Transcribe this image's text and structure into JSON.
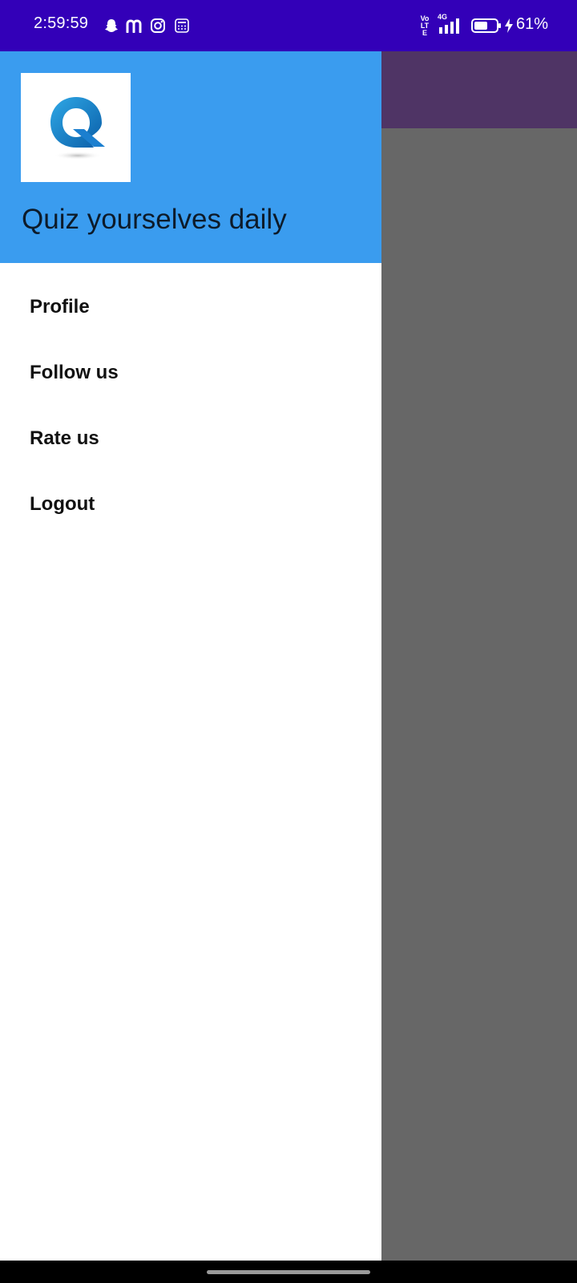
{
  "status_bar": {
    "time": "2:59:59",
    "notification_icons": [
      "snapchat-icon",
      "m-app-icon",
      "instagram-icon",
      "calculator-icon"
    ],
    "system_icons": [
      "volte-icon",
      "signal-4g-icon",
      "battery-icon",
      "charging-icon"
    ],
    "network_label": "4G",
    "volte_label": "Vo LTE",
    "battery_percent": "61%",
    "battery_level": 0.61,
    "background_color": "#3300b8"
  },
  "drawer": {
    "title": "Quiz yourselves daily",
    "logo_icon": "quiz-q-logo",
    "header_color": "#3a9cef",
    "menu_items": [
      {
        "label": "Profile"
      },
      {
        "label": "Follow us"
      },
      {
        "label": "Rate us"
      },
      {
        "label": "Logout"
      }
    ]
  },
  "app_behind": {
    "toolbar_color": "#4f3465",
    "scrim_color": "#676767"
  }
}
